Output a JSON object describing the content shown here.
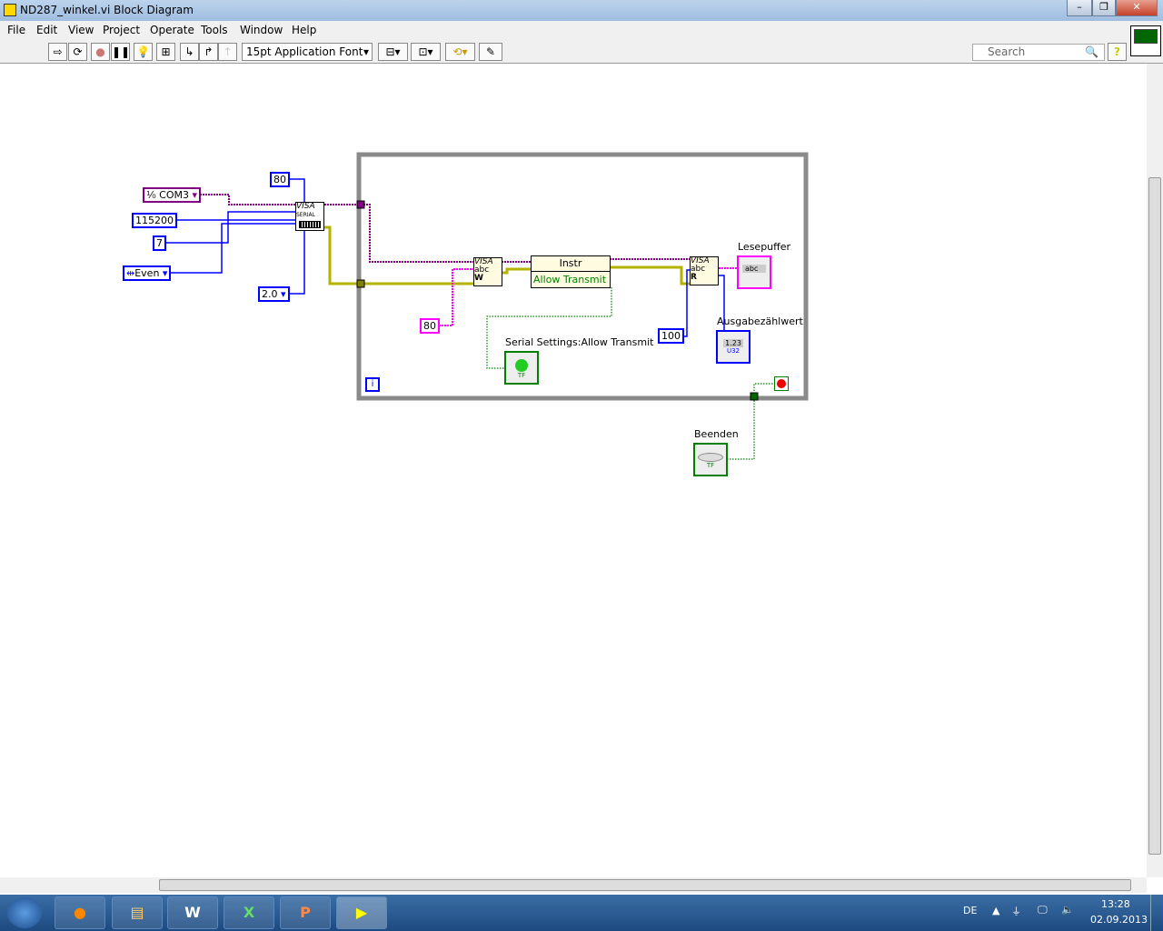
{
  "window": {
    "title": "ND287_winkel.vi Block Diagram",
    "controls": [
      "minimize",
      "restore",
      "close"
    ]
  },
  "menu": [
    "File",
    "Edit",
    "View",
    "Project",
    "Operate",
    "Tools",
    "Window",
    "Help"
  ],
  "toolbar": {
    "font": "15pt Application Font",
    "search_placeholder": "Search",
    "help": "?"
  },
  "diagram": {
    "resource": "COM3",
    "baud": "115200",
    "data_bits": "7",
    "parity": "Even",
    "stop_bits": "2.0",
    "timeout_const": "80",
    "write_const": "80",
    "read_count": "100",
    "serial_node": {
      "line1": "VISA",
      "line2": "SERIAL"
    },
    "property_node": {
      "class": "Instr",
      "property": "Allow Transmit"
    },
    "write_node": {
      "title": "VISA",
      "sub": "abc",
      "mode": "W"
    },
    "read_node": {
      "title": "VISA",
      "sub": "abc",
      "mode": "R"
    },
    "indicators": {
      "lesepuffer": {
        "label": "Lesepuffer",
        "type": "abc"
      },
      "ausgabe": {
        "label": "Ausgabezählwert",
        "value": "1.23",
        "type": "U32"
      },
      "allow_transmit": {
        "label": "Serial Settings:Allow Transmit",
        "type": "TF"
      },
      "beenden": {
        "label": "Beenden",
        "type": "TF"
      }
    },
    "loop_index": "i",
    "colors": {
      "refnum": "#800080",
      "error": "#b3b300",
      "numeric": "#0000ff",
      "string": "#ff00ff",
      "boolean": "#008000",
      "loop": "#8a8a8a"
    }
  },
  "taskbar": {
    "lang": "DE",
    "time": "13:28",
    "date": "02.09.2013",
    "apps": [
      "Firefox",
      "Explorer",
      "W",
      "X",
      "P",
      "LabVIEW"
    ]
  }
}
